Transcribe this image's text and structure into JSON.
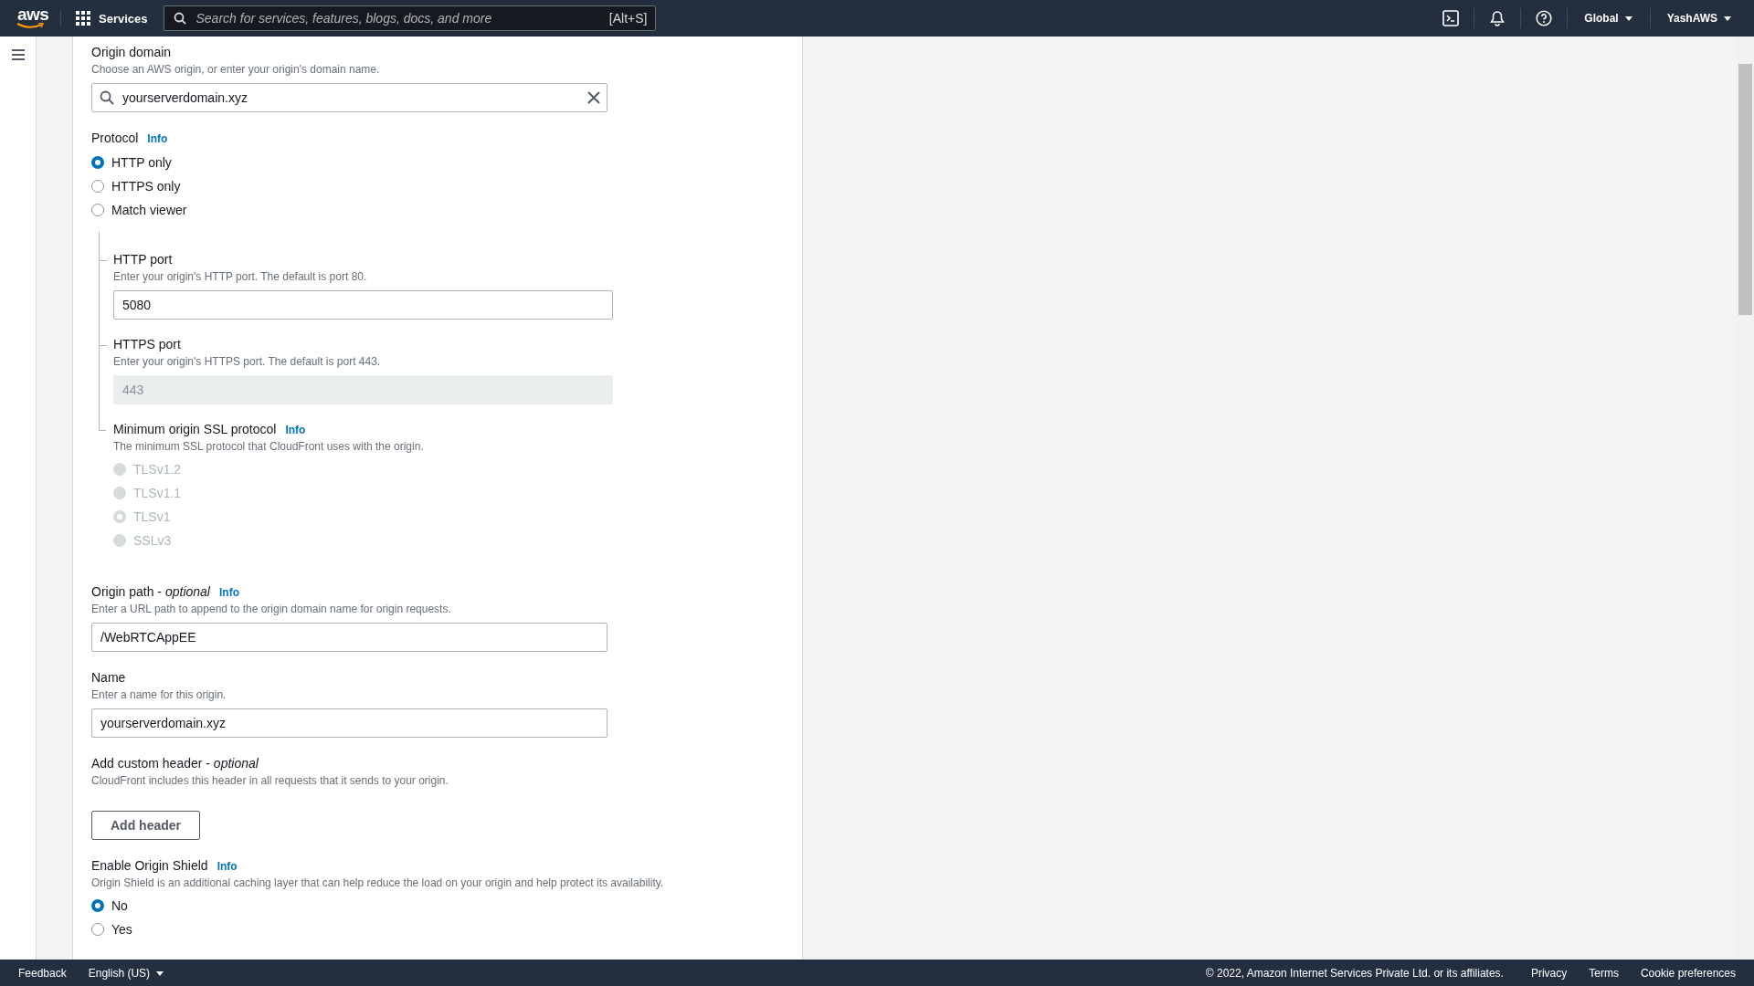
{
  "top_nav": {
    "logo": "aws",
    "services": "Services",
    "search": {
      "placeholder": "Search for services, features, blogs, docs, and more",
      "shortcut": "[Alt+S]"
    },
    "region": "Global",
    "account": "YashAWS"
  },
  "form": [
    {
      "kind": "field",
      "label": "Origin domain",
      "description": "Choose an AWS origin, or enter your origin's domain name.",
      "field": {
        "kind": "search",
        "value": "yourserverdomain.xyz"
      }
    },
    {
      "kind": "radios",
      "label": "Protocol",
      "info": "Info",
      "options": [
        {
          "label": "HTTP only",
          "selected": true,
          "disabled": false
        },
        {
          "label": "HTTPS only",
          "selected": false,
          "disabled": false
        },
        {
          "label": "Match viewer",
          "selected": false,
          "disabled": false
        }
      ]
    },
    {
      "kind": "nested",
      "children": [
        {
          "kind": "field",
          "label": "HTTP port",
          "description": "Enter your origin's HTTP port. The default is port 80.",
          "field": {
            "kind": "text",
            "value": "5080",
            "disabled": false
          }
        },
        {
          "kind": "field",
          "label": "HTTPS port",
          "description": "Enter your origin's HTTPS port. The default is port 443.",
          "field": {
            "kind": "text",
            "value": "443",
            "disabled": true
          }
        },
        {
          "kind": "radios",
          "label": "Minimum origin SSL protocol",
          "info": "Info",
          "description": "The minimum SSL protocol that CloudFront uses with the origin.",
          "options": [
            {
              "label": "TLSv1.2",
              "selected": false,
              "disabled": true
            },
            {
              "label": "TLSv1.1",
              "selected": false,
              "disabled": true
            },
            {
              "label": "TLSv1",
              "selected": true,
              "disabled": true
            },
            {
              "label": "SSLv3",
              "selected": false,
              "disabled": true
            }
          ]
        }
      ]
    },
    {
      "kind": "field",
      "label": "Origin path - *optional*",
      "info": "Info",
      "description": "Enter a URL path to append to the origin domain name for origin requests.",
      "field": {
        "kind": "text",
        "value": "/WebRTCAppEE",
        "disabled": false
      }
    },
    {
      "kind": "field",
      "label": "Name",
      "description": "Enter a name for this origin.",
      "field": {
        "kind": "text",
        "value": "yourserverdomain.xyz",
        "disabled": false
      }
    },
    {
      "kind": "button",
      "label": "Add custom header - *optional*",
      "description": "CloudFront includes this header in all requests that it sends to your origin.",
      "button": "Add header"
    },
    {
      "kind": "radios",
      "label": "Enable Origin Shield",
      "info": "Info",
      "description": "Origin Shield is an additional caching layer that can help reduce the load on your origin and help protect its availability.",
      "options": [
        {
          "label": "No",
          "selected": true,
          "disabled": false
        },
        {
          "label": "Yes",
          "selected": false,
          "disabled": false
        }
      ]
    }
  ],
  "footer": {
    "feedback": "Feedback",
    "language": "English (US)",
    "copyright": "© 2022, Amazon Internet Services Private Ltd. or its affiliates.",
    "links": [
      "Privacy",
      "Terms",
      "Cookie preferences"
    ]
  }
}
